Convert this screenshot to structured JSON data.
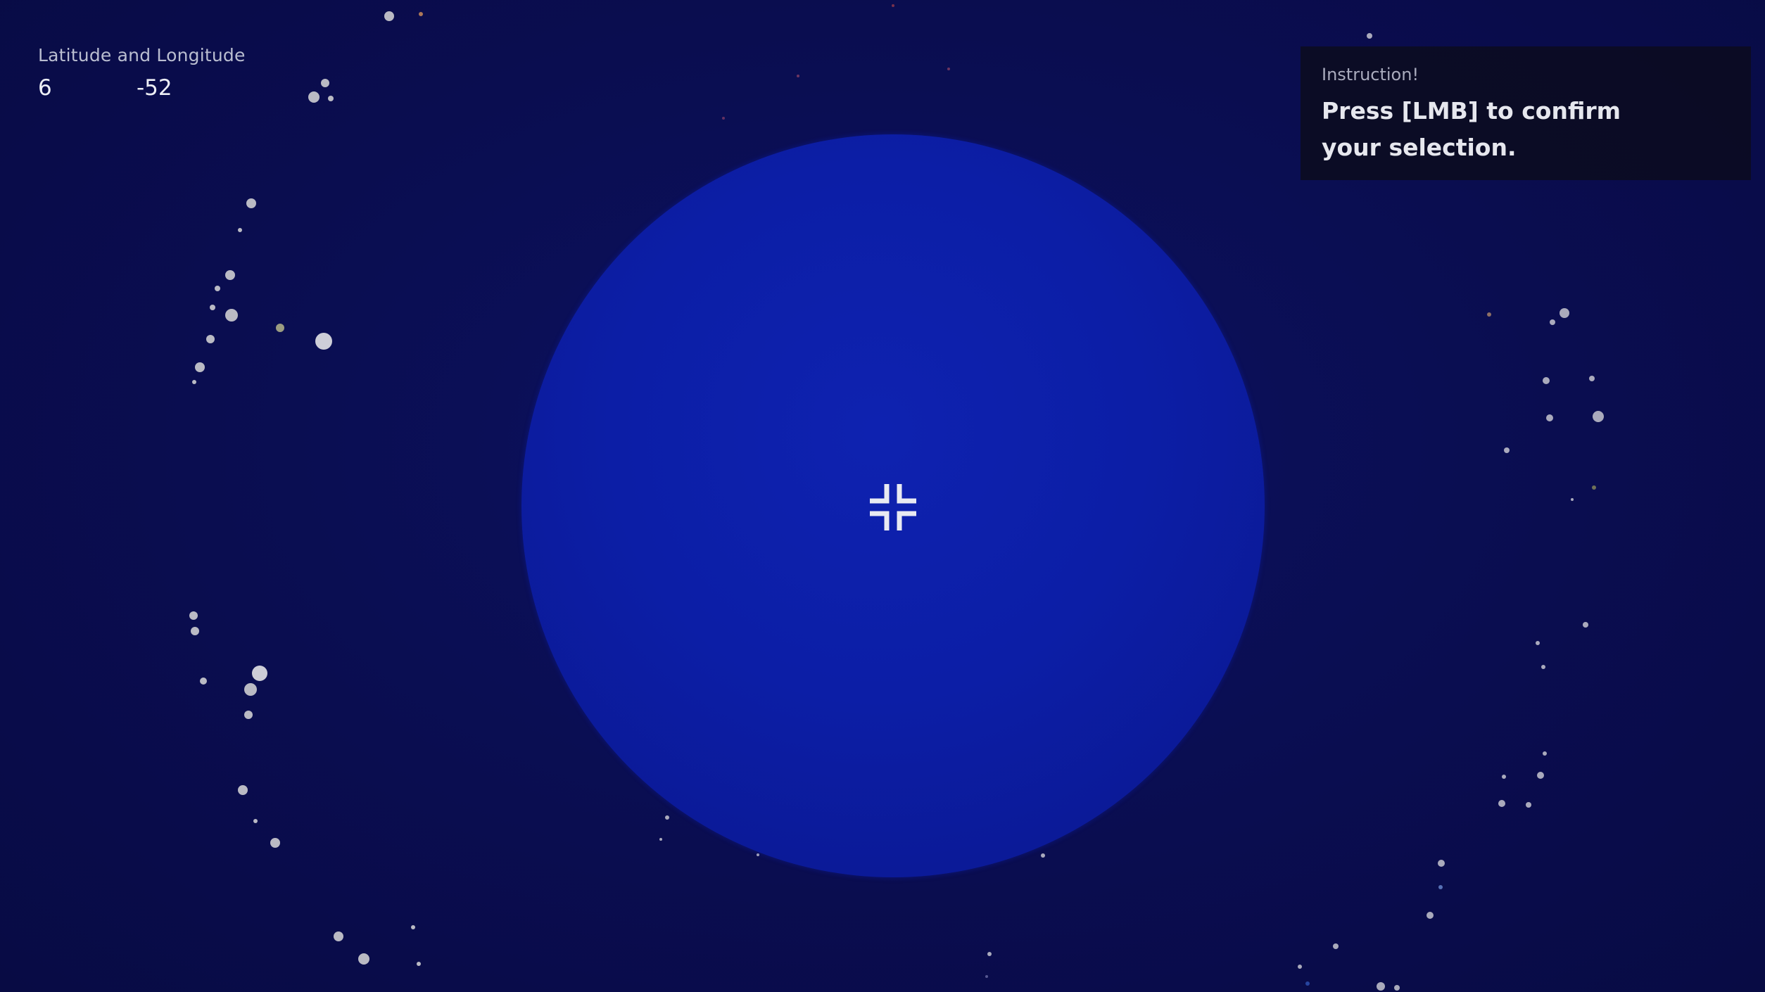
{
  "hud": {
    "coordinates": {
      "title": "Latitude and Longitude",
      "latitude": "6",
      "longitude": "-52"
    },
    "instruction": {
      "title": "Instruction!",
      "text": "Press [LMB] to confirm your selection."
    },
    "crosshair": {
      "icon": "crosshair-icon",
      "color": "#e8eaf2"
    }
  },
  "scene": {
    "background_color": "#0b0e52",
    "globe_color": "#0c1ea6",
    "star_color": "#e6e6e6"
  }
}
